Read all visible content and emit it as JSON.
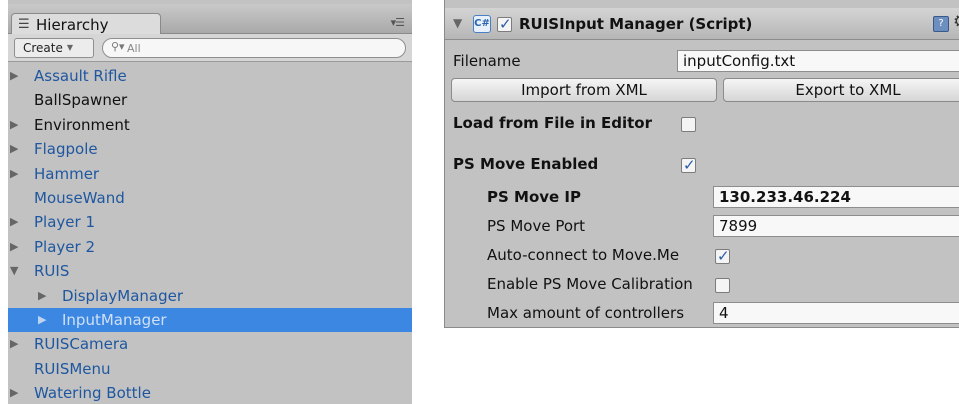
{
  "hierarchy": {
    "tab_label": "Hierarchy",
    "create_label": "Create",
    "search_placeholder": "All",
    "items": [
      {
        "label": "Assault Rifle",
        "arrow": "▶",
        "style": "prefab",
        "depth": 0
      },
      {
        "label": "BallSpawner",
        "arrow": "",
        "style": "plain",
        "depth": 0
      },
      {
        "label": "Environment",
        "arrow": "▶",
        "style": "plain",
        "depth": 0
      },
      {
        "label": "Flagpole",
        "arrow": "▶",
        "style": "prefab",
        "depth": 0
      },
      {
        "label": "Hammer",
        "arrow": "▶",
        "style": "prefab",
        "depth": 0
      },
      {
        "label": "MouseWand",
        "arrow": "",
        "style": "prefab",
        "depth": 0
      },
      {
        "label": "Player 1",
        "arrow": "▶",
        "style": "prefab",
        "depth": 0
      },
      {
        "label": "Player 2",
        "arrow": "▶",
        "style": "prefab",
        "depth": 0
      },
      {
        "label": "RUIS",
        "arrow": "▼",
        "style": "prefab",
        "depth": 0
      },
      {
        "label": "DisplayManager",
        "arrow": "▶",
        "style": "prefab",
        "depth": 1
      },
      {
        "label": "InputManager",
        "arrow": "▶",
        "style": "prefab",
        "depth": 1,
        "selected": true
      },
      {
        "label": "RUISCamera",
        "arrow": "▶",
        "style": "prefab",
        "depth": 0
      },
      {
        "label": "RUISMenu",
        "arrow": "",
        "style": "prefab",
        "depth": 0
      },
      {
        "label": "Watering Bottle",
        "arrow": "▶",
        "style": "prefab",
        "depth": 0
      }
    ]
  },
  "inspector": {
    "component_title": "RUISInput Manager (Script)",
    "enabled": true,
    "filename_label": "Filename",
    "filename_value": "inputConfig.txt",
    "import_label": "Import from XML",
    "export_label": "Export to XML",
    "load_from_file_label": "Load from File in Editor",
    "load_from_file_checked": false,
    "ps_move_enabled_label": "PS Move Enabled",
    "ps_move_enabled_checked": true,
    "ps_move_ip_label": "PS Move IP",
    "ps_move_ip_value": "130.233.46.224",
    "ps_move_port_label": "PS Move Port",
    "ps_move_port_value": "7899",
    "auto_connect_label": "Auto-connect to Move.Me",
    "auto_connect_checked": true,
    "calibration_label": "Enable PS Move Calibration",
    "calibration_checked": false,
    "max_controllers_label": "Max amount of controllers",
    "max_controllers_value": "4"
  },
  "colors": {
    "selection": "#3b87e2",
    "prefab_text": "#1e57a0",
    "panel_bg": "#c2c2c2"
  }
}
